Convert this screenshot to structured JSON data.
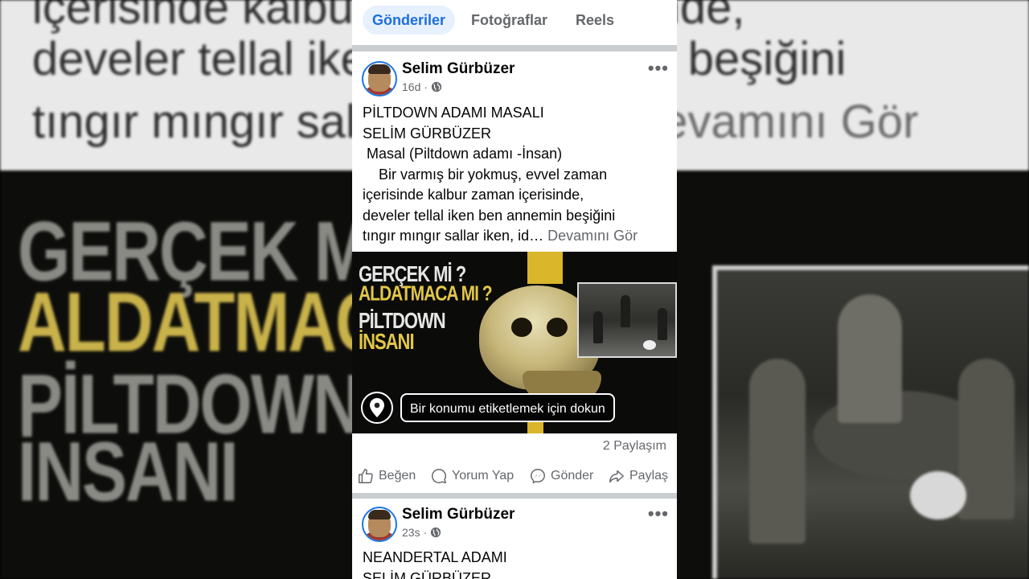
{
  "background": {
    "lines": [
      "içerisinde kalbur zaman içerisinde,",
      "develer tellal iken ben annemin beşiğini",
      "tıngır mıngır sallar iken, id…"
    ],
    "more": "Devamını Gör",
    "big_text": [
      "GERÇEK Mİ ?",
      "ALDATMACA MI ?",
      "PİLTDOWN",
      "İNSANI"
    ]
  },
  "tabs": [
    {
      "label": "Gönderiler",
      "active": true
    },
    {
      "label": "Fotoğraflar",
      "active": false
    },
    {
      "label": "Reels",
      "active": false
    }
  ],
  "posts": [
    {
      "author": "Selim Gürbüzer",
      "time": "16d",
      "separator": "·",
      "lines": [
        "PİLTDOWN ADAMI MASALI",
        "SELİM GÜRBÜZER",
        " Masal (Piltdown adamı -İnsan)",
        "    Bir varmış bir yokmuş, evvel zaman",
        "içerisinde kalbur zaman içerisinde,",
        "develer tellal iken ben annemin beşiğini",
        "tıngır mıngır sallar iken, id…"
      ],
      "see_more": "Devamını Gör",
      "media_text": [
        "GERÇEK Mİ ?",
        "ALDATMACA MI ?",
        "PİLTDOWN",
        "İNSANI"
      ],
      "location_tip": "Bir konumu etiketlemek için dokun",
      "shares": "2 Paylaşım",
      "actions": {
        "like": "Beğen",
        "comment": "Yorum Yap",
        "send": "Gönder",
        "share": "Paylaş"
      }
    },
    {
      "author": "Selim Gürbüzer",
      "time": "23s",
      "separator": "·",
      "lines": [
        "NEANDERTAL ADAMI",
        "SELİM GÜRBÜZER"
      ]
    }
  ],
  "colors": {
    "accent": "#1b6fe0",
    "tab_active_bg": "#e7f0fd",
    "secondary_text": "#65676b"
  }
}
